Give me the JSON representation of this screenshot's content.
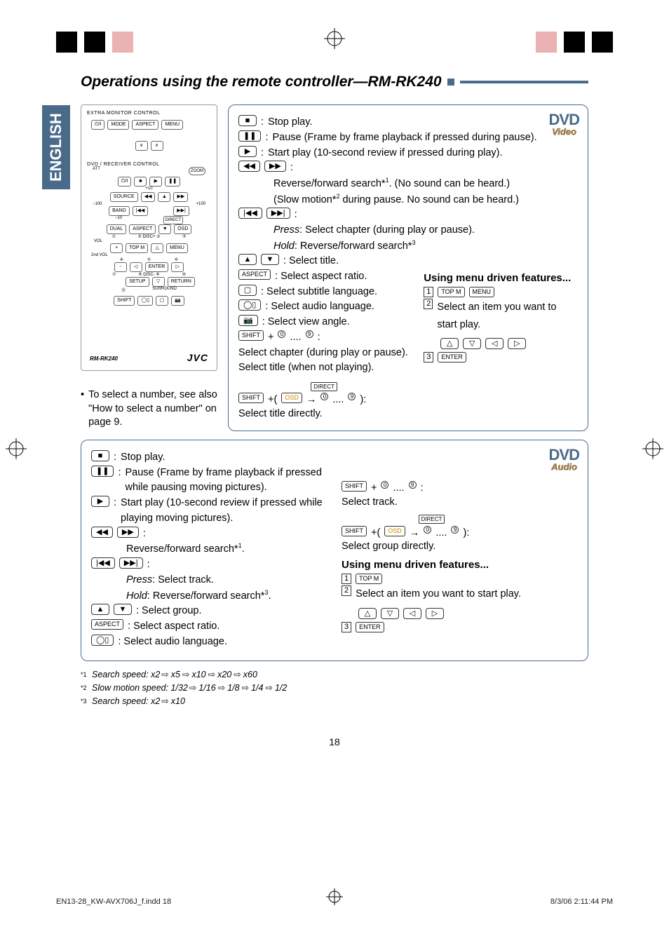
{
  "heading": "Operations using the remote controller—RM-RK240",
  "languageTab": "ENGLISH",
  "remote": {
    "header1": "EXTRA MONITOR CONTROL",
    "header2": "DVD / RECEIVER CONTROL",
    "row1": [
      "⏻/I",
      "MODE",
      "ASPECT",
      "MENU"
    ],
    "row2": [
      "∨",
      "∧"
    ],
    "row3a": "ATT",
    "row3b": "ZOOM",
    "row4": [
      "⏻/I",
      "■",
      "▶",
      "❚❚"
    ],
    "row4label": "+10",
    "row5": [
      "SOURCE",
      "◀◀",
      "▲",
      "▶▶"
    ],
    "row5left": "−100",
    "row5right": "+100",
    "row6": [
      "BAND",
      "|◀◀",
      "",
      "▶▶|"
    ],
    "row6label": "−10",
    "row6label2": "DIRECT",
    "row7": [
      "DUAL",
      "ASPECT",
      "▼",
      "OSD"
    ],
    "row7nums": [
      "①",
      "② DISC+ ②",
      "③"
    ],
    "row8l": "VOL",
    "row8": [
      "+",
      "TOP M",
      "△",
      "MENU"
    ],
    "row8b": "2nd VOL",
    "row8nums": [
      "④",
      "⑤",
      "⑥"
    ],
    "row9": [
      "-",
      "◁",
      "ENTER",
      "▷"
    ],
    "row9nums": [
      "⑦",
      "⑧ DISC- ⑧",
      "⑨"
    ],
    "row10": [
      "",
      "SETUP",
      "▽",
      "RETURN"
    ],
    "row10nums": [
      "⓪",
      "SURROUND"
    ],
    "row11": [
      "SHIFT",
      "◯▯",
      "▢",
      "📷"
    ],
    "model": "RM-RK240",
    "logo": "JVC"
  },
  "remoteNote": "To select a number, see also \"How to select a number\" on page 9.",
  "video": {
    "formatMain": "DVD",
    "formatSub": "Video",
    "lines": [
      {
        "icon": "■",
        "desc": "Stop play."
      },
      {
        "icon": "❚❚",
        "desc": "Pause (Frame by frame playback if pressed during pause)."
      },
      {
        "icon": "▶",
        "desc": "Start play (10-second review if pressed during play)."
      }
    ],
    "rwff": {
      "icons": [
        "◀◀",
        "▶▶"
      ],
      "l1a": "Reverse/forward search*",
      "l1sup": "1",
      "l1b": ". (No sound can be heard.)",
      "l2a": "(Slow motion*",
      "l2sup": "2",
      "l2b": " during pause. No sound can be heard.)"
    },
    "prevnext": {
      "icons": [
        "|◀◀",
        "▶▶|"
      ],
      "pressLabel": "Press",
      "pressDesc": ":  Select chapter (during play or pause).",
      "holdLabel": "Hold",
      "holdDescA": ":  Reverse/forward search*",
      "holdSup": "3"
    },
    "updown": {
      "icons": [
        "▲",
        "▼"
      ],
      "desc": ": Select title."
    },
    "aspect": {
      "btn": "ASPECT",
      "desc": ":  Select aspect ratio."
    },
    "subtitle": {
      "icon": "▢",
      "desc": ":  Select subtitle language."
    },
    "audio": {
      "icon": "◯▯",
      "desc": ":  Select audio language."
    },
    "angle": {
      "icon": "📷",
      "desc": ":  Select view angle."
    },
    "shift09": {
      "btn": "SHIFT",
      "plus": "+",
      "n0": "0",
      "dots": "....",
      "n9": "9",
      "colon": " :",
      "l1": "Select chapter (during play or pause).",
      "l2": "Select title (when not playing)."
    },
    "direct": {
      "directBtn": "DIRECT",
      "shiftBtn": "SHIFT",
      "osdBtn": "OSD",
      "arrow": "→",
      "n0": "0",
      "dots": "....",
      "n9": "9",
      "paren": " ):",
      "desc": "Select title directly."
    },
    "menuHeader": "Using menu driven features...",
    "step1btns": [
      "TOP M",
      "MENU"
    ],
    "step2": "Select an item you want to start play.",
    "step2arrows": [
      "△",
      "▽",
      "◁",
      "▷"
    ],
    "step3btn": "ENTER"
  },
  "audio": {
    "formatMain": "DVD",
    "formatSub": "Audio",
    "stop": {
      "icon": "■",
      "desc": "Stop play."
    },
    "pause": {
      "icon": "❚❚",
      "desc": "Pause (Frame by frame playback if pressed while pausing moving pictures)."
    },
    "play": {
      "icon": "▶",
      "desc": "Start play (10-second review if pressed while playing moving pictures)."
    },
    "rwff": {
      "icons": [
        "◀◀",
        "▶▶"
      ],
      "descA": "Reverse/forward search*",
      "sup": "1",
      "descB": "."
    },
    "prevnext": {
      "icons": [
        "|◀◀",
        "▶▶|"
      ],
      "pressLabel": "Press",
      "pressDesc": ":  Select track.",
      "holdLabel": "Hold",
      "holdDescA": ":  Reverse/forward search*",
      "holdSup": "3",
      "holdDescB": "."
    },
    "updown": {
      "icons": [
        "▲",
        "▼"
      ],
      "desc": ": Select group."
    },
    "aspect": {
      "btn": "ASPECT",
      "desc": ":  Select aspect ratio."
    },
    "audioLang": {
      "icon": "◯▯",
      "desc": ":  Select audio language."
    },
    "shift09": {
      "btn": "SHIFT",
      "plus": "+",
      "n0": "0",
      "dots": "....",
      "n9": "9",
      "colon": " :",
      "desc": "Select track."
    },
    "direct": {
      "directBtn": "DIRECT",
      "shiftBtn": "SHIFT",
      "osdBtn": "OSD",
      "arrow": "→",
      "n0": "0",
      "dots": "....",
      "n9": "9",
      "paren": " ):",
      "desc": "Select group directly."
    },
    "menuHeader": "Using menu driven features...",
    "step1btns": [
      "TOP M"
    ],
    "step2": "Select an item you want to start play.",
    "step2arrows": [
      "△",
      "▽",
      "◁",
      "▷"
    ],
    "step3btn": "ENTER"
  },
  "footnotes": {
    "f1": {
      "sup": "*1",
      "label": "Search speed: x2",
      "vals": [
        "x5",
        "x10",
        "x20",
        "x60"
      ]
    },
    "f2": {
      "sup": "*2",
      "label": "Slow motion speed: 1/32",
      "vals": [
        "1/16",
        "1/8",
        "1/4",
        "1/2"
      ]
    },
    "f3": {
      "sup": "*3",
      "label": "Search speed: x2",
      "vals": [
        "x10"
      ]
    }
  },
  "pageNum": "18",
  "footer": {
    "left": "EN13-28_KW-AVX706J_f.indd   18",
    "right": "8/3/06   2:11:44 PM"
  }
}
